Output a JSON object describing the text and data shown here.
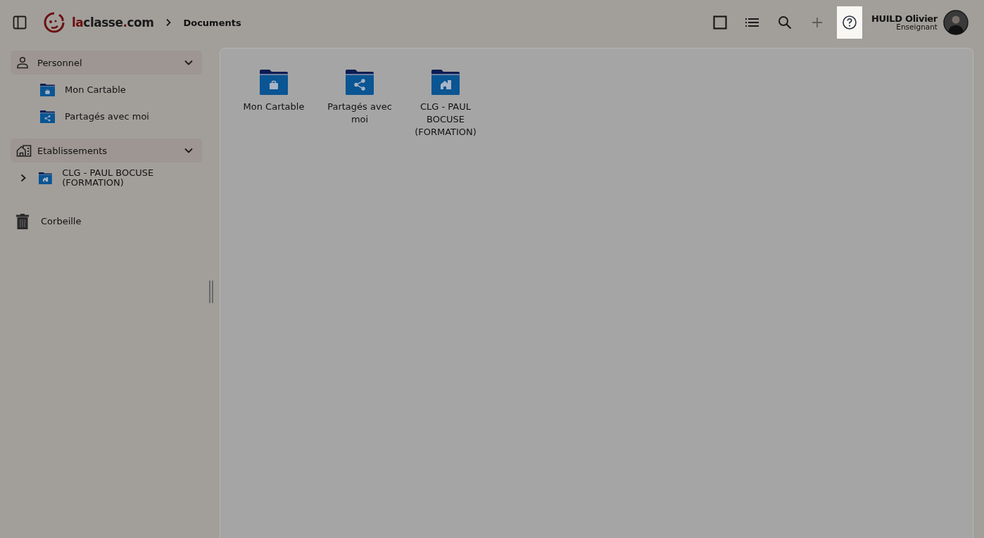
{
  "header": {
    "logo": [
      {
        "text": "la",
        "accent": true
      },
      {
        "text": "classe",
        "accent": false
      },
      {
        "text": ".",
        "accent": true
      },
      {
        "text": "com",
        "accent": false
      }
    ],
    "breadcrumb": "Documents",
    "toolbar": [
      {
        "kind": "tiles",
        "disabled": false,
        "highlighted": false
      },
      {
        "kind": "list",
        "disabled": false,
        "highlighted": false
      },
      {
        "kind": "search",
        "disabled": false,
        "highlighted": false
      },
      {
        "kind": "add",
        "disabled": true,
        "highlighted": false
      },
      {
        "kind": "help",
        "disabled": false,
        "highlighted": true
      }
    ],
    "user": {
      "name": "HUILD Olivier",
      "role": "Enseignant"
    }
  },
  "sidebar": {
    "sections": [
      {
        "kind": "person",
        "label": "Personnel",
        "expanded": true,
        "items": [
          {
            "kind": "briefcase",
            "label": "Mon Cartable"
          },
          {
            "kind": "share",
            "label": "Partagés avec moi"
          }
        ]
      },
      {
        "kind": "building",
        "label": "Etablissements",
        "expanded": true,
        "items": [
          {
            "kind": "building",
            "label": "CLG - PAUL BOCUSE (FORMATION)",
            "expanded": false
          }
        ]
      }
    ],
    "trash": "Corbeille"
  },
  "folders": [
    {
      "kind": "briefcase",
      "label": "Mon Cartable"
    },
    {
      "kind": "share",
      "label": "Partagés avec moi"
    },
    {
      "kind": "building",
      "label": "CLG - PAUL BOCUSE (FORMATION)"
    }
  ]
}
